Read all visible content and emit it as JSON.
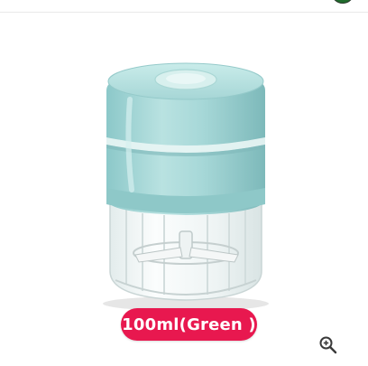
{
  "product": {
    "image_icon": "mini-electric-chopper-image",
    "variant_label": "100ml(Green )",
    "accent_color": "#e8184f",
    "body_color": "#9fd3d3"
  },
  "controls": {
    "zoom_icon": "zoom-in-icon",
    "top_badge_icon": "green-badge-icon"
  }
}
